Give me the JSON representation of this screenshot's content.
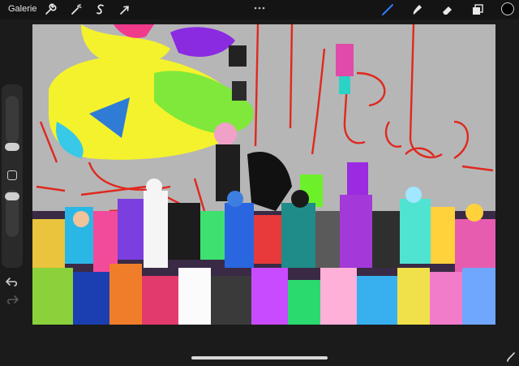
{
  "topbar": {
    "gallery_label": "Galerie",
    "actions_icon": "wrench-icon",
    "adjustments_icon": "magic-wand-icon",
    "selection_icon": "selection-s-icon",
    "transform_icon": "arrow-cursor-icon",
    "brush_icon": "brush-icon",
    "smudge_icon": "smudge-icon",
    "eraser_icon": "eraser-icon",
    "layers_icon": "layers-icon",
    "active_color": "#000000",
    "tool_active_color": "#2f7bff"
  },
  "canvas": {
    "background": "#b6b6b6"
  },
  "sidebar": {
    "undo_icon": "undo-arrow-icon",
    "redo_icon": "redo-arrow-icon",
    "modify_icon": "square-icon"
  }
}
